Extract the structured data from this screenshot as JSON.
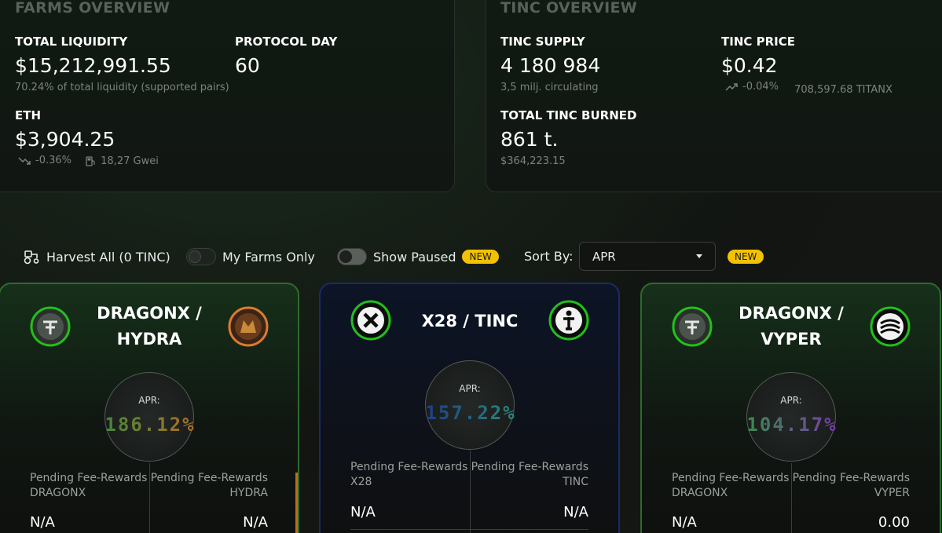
{
  "farms_overview": {
    "title": "FARMS OVERVIEW",
    "total_liquidity_label": "TOTAL LIQUIDITY",
    "total_liquidity_value": "$15,212,991.55",
    "total_liquidity_sub": "70.24% of total liquidity (supported pairs)",
    "protocol_day_label": "PROTOCOL DAY",
    "protocol_day_value": "60",
    "eth_label": "ETH",
    "eth_value": "$3,904.25",
    "eth_change": "-0.36%",
    "eth_gas": "18,27 Gwei"
  },
  "tinc_overview": {
    "title": "TINC OVERVIEW",
    "supply_label": "TINC SUPPLY",
    "supply_value": "4 180 984",
    "supply_sub": "3,5 milj. circulating",
    "price_label": "TINC PRICE",
    "price_value": "$0.42",
    "price_change": "-0.04%",
    "price_titanx": "708,597.68 TITANX",
    "burned_label": "TOTAL TINC BURNED",
    "burned_value": "861 t.",
    "burned_sub": "$364,223.15"
  },
  "toolbar": {
    "harvest_all": "Harvest All (0 TINC)",
    "my_farms_only": "My Farms Only",
    "show_paused": "Show Paused",
    "new_badge_1": "NEW",
    "sort_by_label": "Sort By:",
    "sort_selected": "APR",
    "new_badge_2": "NEW"
  },
  "farms": [
    {
      "title_line1": "DRAGONX /",
      "title_line2": "HYDRA",
      "apr_label": "APR:",
      "apr_value": "186.12%",
      "fee_left_label": "Pending Fee-Rewards",
      "fee_left_token": "DRAGONX",
      "fee_left_value": "N/A",
      "fee_right_label": "Pending Fee-Rewards",
      "fee_right_token": "HYDRA",
      "fee_right_value": "N/A"
    },
    {
      "title": "X28 / TINC",
      "apr_label": "APR:",
      "apr_value": "157.22%",
      "fee_left_label": "Pending Fee-Rewards",
      "fee_left_token": "X28",
      "fee_left_value": "N/A",
      "fee_right_label": "Pending Fee-Rewards",
      "fee_right_token": "TINC",
      "fee_right_value": "N/A"
    },
    {
      "title_line1": "DRAGONX /",
      "title_line2": "VYPER",
      "apr_label": "APR:",
      "apr_value": "104.17%",
      "fee_left_label": "Pending Fee-Rewards",
      "fee_left_token": "DRAGONX",
      "fee_left_value": "N/A",
      "fee_right_label": "Pending Fee-Rewards",
      "fee_right_token": "VYPER",
      "fee_right_value": "0.00"
    }
  ],
  "colors": {
    "accent_green": "#22c01a",
    "badge_yellow": "#f2c200",
    "apr_gradient_1": [
      "#2e8b3e",
      "#c56a1e"
    ],
    "apr_gradient_2": [
      "#1a2f8a",
      "#2a9a7a"
    ],
    "apr_gradient_3": [
      "#2a9a3a",
      "#8a2ac0"
    ]
  }
}
